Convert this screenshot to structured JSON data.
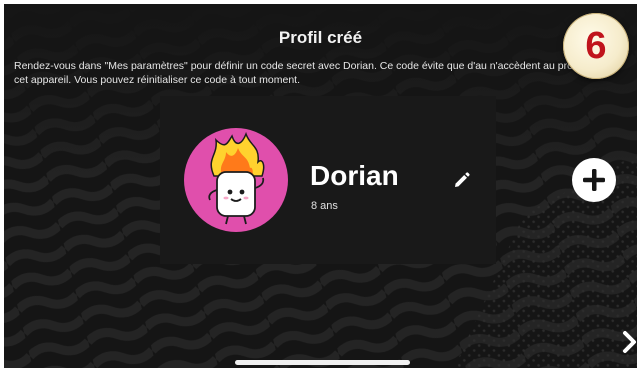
{
  "header": {
    "title": "Profil créé"
  },
  "notice": {
    "text": "Rendez-vous dans \"Mes paramètres\" pour définir un code secret avec Dorian. Ce code évite que d'au n'accèdent au profil depuis cet appareil. Vous pouvez réinitialiser ce code à tout moment."
  },
  "profile": {
    "name": "Dorian",
    "age": "8 ans",
    "avatar_icon": "marshmallow-flame-avatar",
    "avatar_bg_color": "#e04fac"
  },
  "actions": {
    "edit_icon": "pencil-icon",
    "add_icon": "plus-icon",
    "next_icon": "chevron-right-icon"
  },
  "step_badge": {
    "number": "6",
    "color": "#c0141c"
  }
}
